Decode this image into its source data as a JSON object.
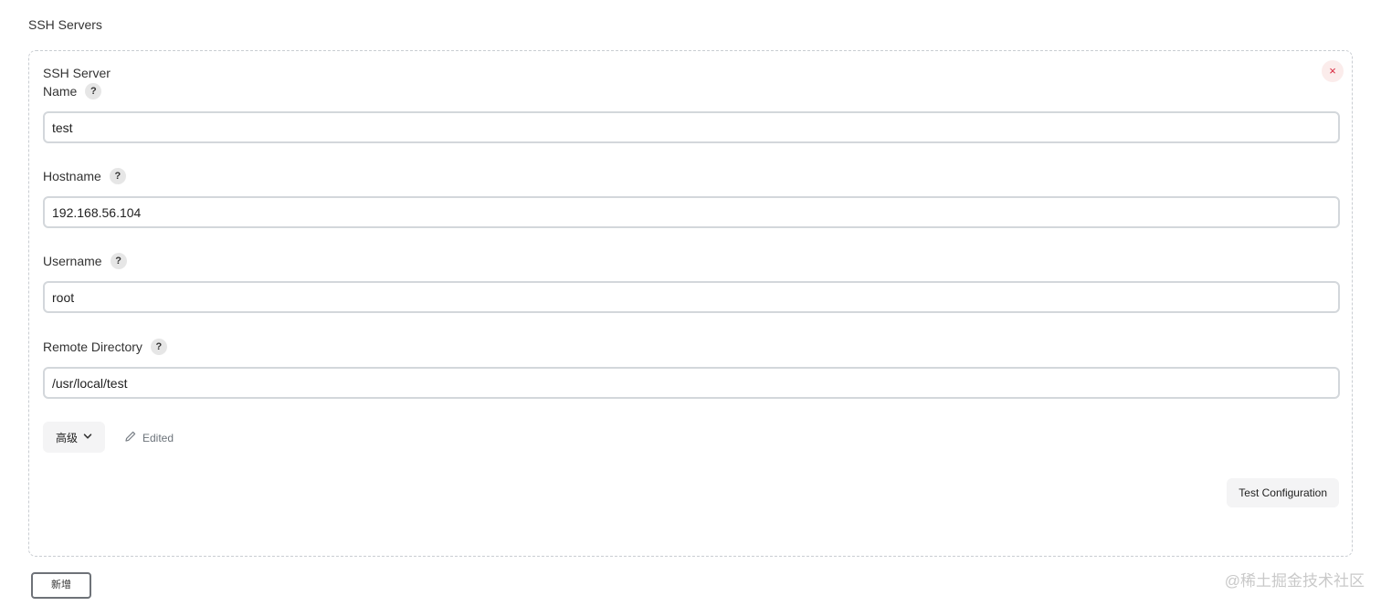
{
  "section_title": "SSH Servers",
  "server": {
    "title": "SSH Server",
    "close_symbol": "×",
    "fields": {
      "name": {
        "label": "Name",
        "value": "test"
      },
      "hostname": {
        "label": "Hostname",
        "value": "192.168.56.104"
      },
      "username": {
        "label": "Username",
        "value": "root"
      },
      "remote_directory": {
        "label": "Remote Directory",
        "value": "/usr/local/test"
      }
    },
    "help_symbol": "?",
    "advanced_label": "高级",
    "edited_label": "Edited",
    "test_button_label": "Test Configuration"
  },
  "add_button_label": "新增",
  "watermark": "@稀土掘金技术社区",
  "colors": {
    "close_icon": "#d7263d",
    "close_bg": "#fbeceb",
    "border": "#c9cdd2"
  },
  "icons": [
    "close-icon",
    "help-icon",
    "chevron-down-icon",
    "pencil-icon"
  ]
}
